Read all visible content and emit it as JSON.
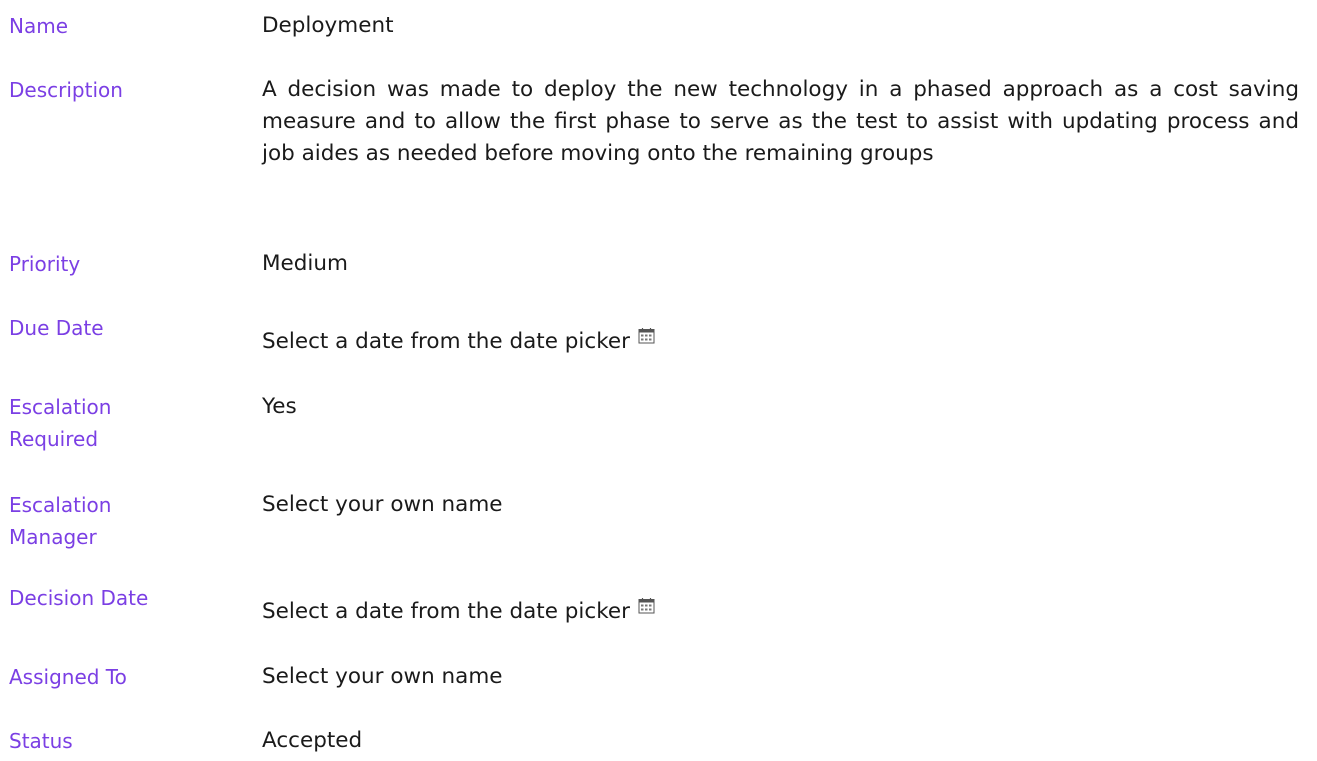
{
  "fields": {
    "name": {
      "label": "Name",
      "value": "Deployment"
    },
    "description": {
      "label": "Description",
      "value": "A decision was made to deploy the new technology in a phased approach as a cost saving measure and to allow the first phase to serve as the test to assist with updating process and job aides as needed before moving onto the remaining groups"
    },
    "priority": {
      "label": "Priority",
      "value": "Medium"
    },
    "due_date": {
      "label": "Due Date",
      "value": "Select a date from the date picker",
      "icon": "calendar-icon"
    },
    "escalation_required": {
      "label_line1": "Escalation",
      "label_line2": "Required",
      "value": "Yes"
    },
    "escalation_manager": {
      "label_line1": "Escalation",
      "label_line2": "Manager",
      "value": "Select your own name"
    },
    "decision_date": {
      "label": "Decision Date",
      "value": "Select a date from the date picker",
      "icon": "calendar-icon"
    },
    "assigned_to": {
      "label": "Assigned To",
      "value": "Select your own name"
    },
    "status": {
      "label": "Status",
      "value": "Accepted"
    }
  },
  "colors": {
    "label": "#7b3fe4",
    "value": "#1a1a1a",
    "icon": "#555555"
  }
}
